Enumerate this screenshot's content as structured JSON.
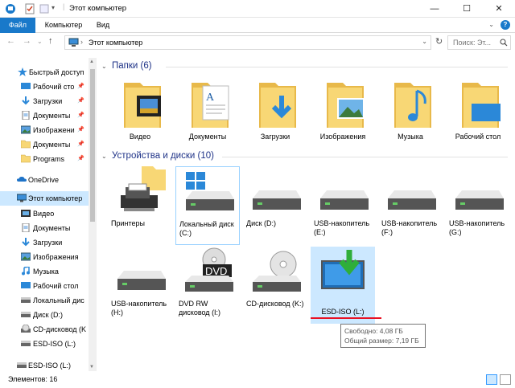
{
  "window": {
    "title": "Этот компьютер",
    "minimize": "—",
    "maximize": "☐",
    "close": "✕"
  },
  "ribbon": {
    "tabs": [
      "Файл",
      "Компьютер",
      "Вид"
    ],
    "expand": "⌄",
    "help": "?"
  },
  "address": {
    "back": "←",
    "forward": "→",
    "recent": "⌄",
    "up": "↑",
    "breadcrumb_sep": "›",
    "location": "Этот компьютер",
    "dropdown": "⌄",
    "refresh": "↻"
  },
  "search": {
    "placeholder": "Поиск: Эт..."
  },
  "sidebar": {
    "items": [
      {
        "label": "Быстрый доступ",
        "icon": "star-icon"
      },
      {
        "label": "Рабочий сто",
        "icon": "desktop-icon",
        "pinned": true
      },
      {
        "label": "Загрузки",
        "icon": "download-icon",
        "pinned": true
      },
      {
        "label": "Документы",
        "icon": "documents-icon",
        "pinned": true
      },
      {
        "label": "Изображени",
        "icon": "pictures-icon",
        "pinned": true
      },
      {
        "label": "Документы",
        "icon": "folder-icon",
        "pinned": true
      },
      {
        "label": "Programs",
        "icon": "folder-icon",
        "pinned": true
      },
      {
        "label": "OneDrive",
        "icon": "cloud-icon"
      },
      {
        "label": "Этот компьютер",
        "icon": "computer-icon",
        "selected": true
      },
      {
        "label": "Видео",
        "icon": "video-icon"
      },
      {
        "label": "Документы",
        "icon": "documents-icon"
      },
      {
        "label": "Загрузки",
        "icon": "download-icon"
      },
      {
        "label": "Изображения",
        "icon": "pictures-icon"
      },
      {
        "label": "Музыка",
        "icon": "music-icon"
      },
      {
        "label": "Рабочий стол",
        "icon": "desktop-icon"
      },
      {
        "label": "Локальный дис",
        "icon": "drive-icon"
      },
      {
        "label": "Диск (D:)",
        "icon": "drive-icon"
      },
      {
        "label": "CD-дисковод (K",
        "icon": "cd-drive-icon"
      },
      {
        "label": "ESD-ISO (L:)",
        "icon": "usb-drive-icon"
      },
      {
        "label": "ESD-ISO (L:)",
        "icon": "usb-drive-icon"
      }
    ],
    "pin_glyph": "📌"
  },
  "groups": {
    "folders": "Папки (6)",
    "devices": "Устройства и диски (10)",
    "chevron": "⌄"
  },
  "folders": [
    {
      "label": "Видео",
      "icon": "video-folder-icon"
    },
    {
      "label": "Документы",
      "icon": "documents-folder-icon"
    },
    {
      "label": "Загрузки",
      "icon": "downloads-folder-icon"
    },
    {
      "label": "Изображения",
      "icon": "pictures-folder-icon"
    },
    {
      "label": "Музыка",
      "icon": "music-folder-icon"
    },
    {
      "label": "Рабочий стол",
      "icon": "desktop-folder-icon"
    }
  ],
  "devices": [
    {
      "label": "Принтеры",
      "icon": "printer-icon"
    },
    {
      "label": "Локальный диск (C:)",
      "icon": "windows-drive-icon"
    },
    {
      "label": "Диск (D:)",
      "icon": "hard-drive-icon"
    },
    {
      "label": "USB-накопитель (E:)",
      "icon": "usb-drive-icon"
    },
    {
      "label": "USB-накопитель (F:)",
      "icon": "usb-drive-icon"
    },
    {
      "label": "USB-накопитель (G:)",
      "icon": "usb-drive-icon"
    },
    {
      "label": "USB-накопитель (H:)",
      "icon": "usb-drive-icon"
    },
    {
      "label": "DVD RW дисковод (I:)",
      "icon": "dvd-drive-icon"
    },
    {
      "label": "CD-дисковод (K:)",
      "icon": "cd-drive-icon"
    },
    {
      "label": "ESD-ISO (L:)",
      "icon": "esd-iso-icon",
      "selected": true
    }
  ],
  "dvd_badge": "DVD",
  "tooltip": {
    "free": "Свободно: 4,08 ГБ",
    "total": "Общий размер: 7,19 ГБ"
  },
  "status": {
    "count": "Элементов: 16"
  },
  "colors": {
    "accent": "#1979ca",
    "folder": "#f8d775",
    "selection": "#cce8ff",
    "header": "#1e3287",
    "underline": "#e81123"
  }
}
